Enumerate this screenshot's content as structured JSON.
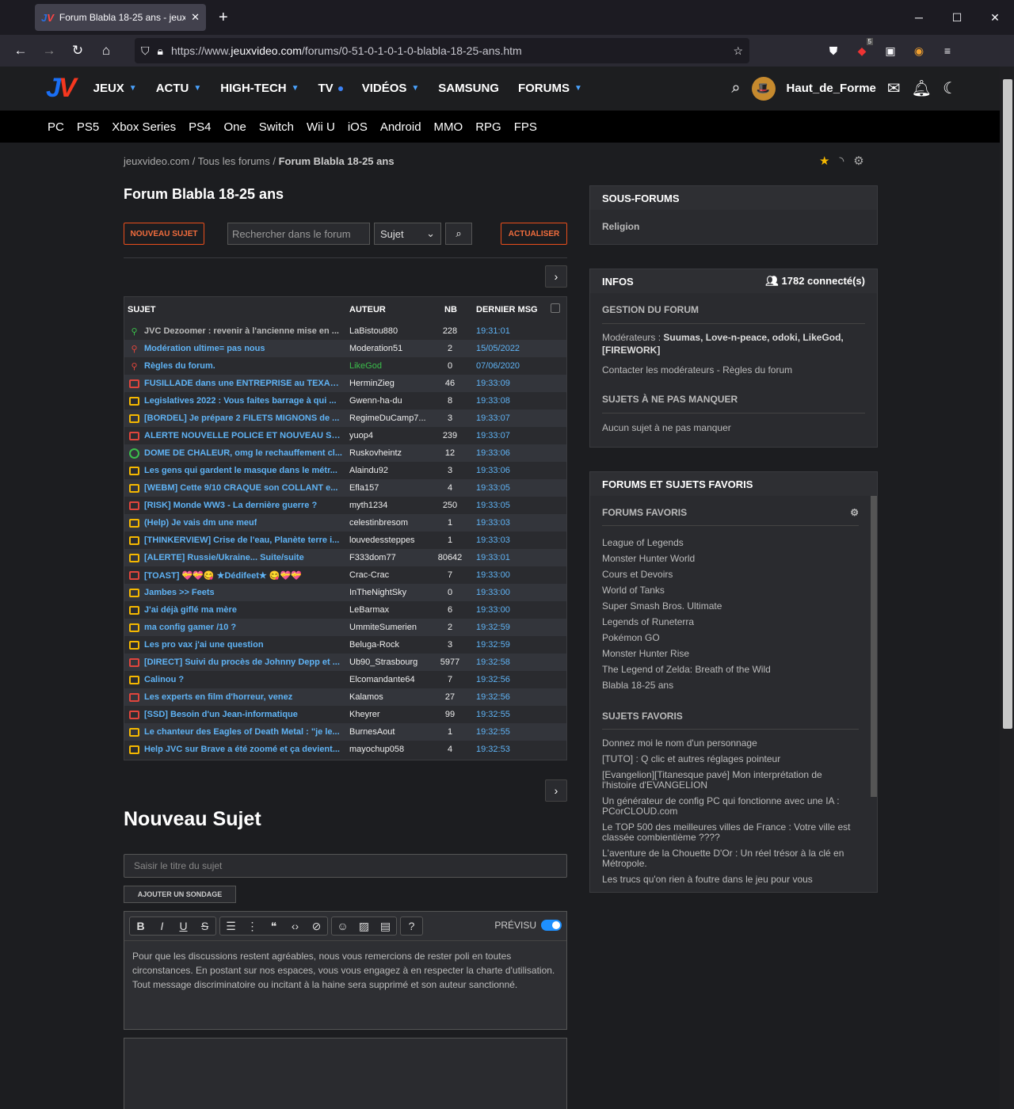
{
  "browser": {
    "tab_title": "Forum Blabla 18-25 ans - jeuxvi",
    "url_prefix": "https://www.",
    "url_domain": "jeuxvideo.com",
    "url_path": "/forums/0-51-0-1-0-1-0-blabla-18-25-ans.htm",
    "ext_badge": "5"
  },
  "site": {
    "nav": [
      {
        "label": "JEUX",
        "marker": "caret"
      },
      {
        "label": "ACTU",
        "marker": "caret"
      },
      {
        "label": "HIGH-TECH",
        "marker": "caret"
      },
      {
        "label": "TV",
        "marker": "dot"
      },
      {
        "label": "VIDÉOS",
        "marker": "caret"
      },
      {
        "label": "SAMSUNG",
        "marker": ""
      },
      {
        "label": "FORUMS",
        "marker": "caret"
      }
    ],
    "username": "Haut_de_Forme",
    "platforms": [
      "PC",
      "PS5",
      "Xbox Series",
      "PS4",
      "One",
      "Switch",
      "Wii U",
      "iOS",
      "Android",
      "MMO",
      "RPG",
      "FPS"
    ]
  },
  "breadcrumb": {
    "home": "jeuxvideo.com",
    "forums": "Tous les forums",
    "current": "Forum Blabla 18-25 ans"
  },
  "page_title": "Forum Blabla 18-25 ans",
  "toolbar": {
    "new_topic": "NOUVEAU SUJET",
    "search_placeholder": "Rechercher dans le forum",
    "search_scope": "Sujet",
    "refresh": "ACTUALISER"
  },
  "table": {
    "headers": {
      "subject": "SUJET",
      "author": "AUTEUR",
      "nb": "NB",
      "last": "DERNIER MSG"
    },
    "rows": [
      {
        "icon": "pin-green",
        "title": "JVC Dezoomer : revenir à l'ancienne mise en ...",
        "author": "LaBistou880",
        "nb": "228",
        "date": "19:31:01"
      },
      {
        "icon": "pin-red",
        "title": "Modération ultime= pas nous",
        "author": "Moderation51",
        "nb": "2",
        "date": "15/05/2022"
      },
      {
        "icon": "pin-red",
        "title": "Règles du forum.",
        "author": "LikeGod",
        "nb": "0",
        "date": "07/06/2020",
        "author_color": "#3bbf4b"
      },
      {
        "icon": "folder-red",
        "title": "FUSILLADE dans une ENTREPRISE au TEXAS ...",
        "author": "HerminZieg",
        "nb": "46",
        "date": "19:33:09"
      },
      {
        "icon": "folder",
        "title": "Legislatives 2022 : Vous faites barrage à qui ...",
        "author": "Gwenn-ha-du",
        "nb": "8",
        "date": "19:33:08"
      },
      {
        "icon": "folder",
        "title": "[BORDEL] Je prépare 2 FILETS MIGNONS de ...",
        "author": "RegimeDuCamp7...",
        "nb": "3",
        "date": "19:33:07"
      },
      {
        "icon": "folder-red",
        "title": "ALERTE NOUVELLE POLICE ET NOUVEAU SM...",
        "author": "yuop4",
        "nb": "239",
        "date": "19:33:07"
      },
      {
        "icon": "check",
        "title": "DOME DE CHALEUR, omg le rechauffement cl...",
        "author": "Ruskovheintz",
        "nb": "12",
        "date": "19:33:06"
      },
      {
        "icon": "folder",
        "title": "Les gens qui gardent le masque dans le métr...",
        "author": "Alaindu92",
        "nb": "3",
        "date": "19:33:06"
      },
      {
        "icon": "folder",
        "title": "[WEBM] Cette 9/10 CRAQUE son COLLANT e...",
        "author": "Efla157",
        "nb": "4",
        "date": "19:33:05"
      },
      {
        "icon": "folder-red",
        "title": "[RISK] Monde WW3 - La dernière guerre ?",
        "author": "myth1234",
        "nb": "250",
        "date": "19:33:05"
      },
      {
        "icon": "folder",
        "title": "(Help) Je vais dm une meuf",
        "author": "celestinbresom",
        "nb": "1",
        "date": "19:33:03"
      },
      {
        "icon": "folder",
        "title": "[THINKERVIEW] Crise de l'eau, Planète terre i...",
        "author": "louvedessteppes",
        "nb": "1",
        "date": "19:33:03"
      },
      {
        "icon": "folder",
        "title": "[ALERTE] Russie/Ukraine... Suite/suite",
        "author": "F333dom77",
        "nb": "80642",
        "date": "19:33:01"
      },
      {
        "icon": "folder-red",
        "title": "[TOAST] 💝💝😋 ★Dédifeet★ 😋💝💝",
        "author": "Crac-Crac",
        "nb": "7",
        "date": "19:33:00"
      },
      {
        "icon": "folder",
        "title": "Jambes >> Feets",
        "author": "InTheNightSky",
        "nb": "0",
        "date": "19:33:00"
      },
      {
        "icon": "folder",
        "title": "J'ai déjà giflé ma mère",
        "author": "LeBarmax",
        "nb": "6",
        "date": "19:33:00"
      },
      {
        "icon": "folder",
        "title": "ma config gamer /10 ?",
        "author": "UmmiteSumerien",
        "nb": "2",
        "date": "19:32:59"
      },
      {
        "icon": "folder",
        "title": "Les pro vax j'ai une question",
        "author": "Beluga-Rock",
        "nb": "3",
        "date": "19:32:59"
      },
      {
        "icon": "folder-red",
        "title": "[DIRECT] Suivi du procès de Johnny Depp et ...",
        "author": "Ub90_Strasbourg",
        "nb": "5977",
        "date": "19:32:58"
      },
      {
        "icon": "folder",
        "title": "Calinou ?",
        "author": "Elcomandante64",
        "nb": "7",
        "date": "19:32:56"
      },
      {
        "icon": "folder-red",
        "title": "Les experts en film d'horreur, venez",
        "author": "Kalamos",
        "nb": "27",
        "date": "19:32:56"
      },
      {
        "icon": "folder-red",
        "title": "[SSD] Besoin d'un Jean-informatique",
        "author": "Kheyrer",
        "nb": "99",
        "date": "19:32:55"
      },
      {
        "icon": "folder",
        "title": "Le chanteur des Eagles of Death Metal : \"je le...",
        "author": "BurnesAout",
        "nb": "1",
        "date": "19:32:55"
      },
      {
        "icon": "folder",
        "title": "Help JVC sur Brave a été zoomé et ça devient...",
        "author": "mayochup058",
        "nb": "4",
        "date": "19:32:53"
      }
    ]
  },
  "new_topic": {
    "heading": "Nouveau Sujet",
    "title_placeholder": "Saisir le titre du sujet",
    "poll_button": "AJOUTER UN SONDAGE",
    "preview_label": "PRÉVISU",
    "notice": "Pour que les discussions restent agréables, nous vous remercions de rester poli en toutes circonstances. En postant sur nos espaces, vous vous engagez à en respecter la charte d'utilisation. Tout message discriminatoire ou incitant à la haine sera supprimé et son auteur sanctionné."
  },
  "sidebar": {
    "subforums_title": "SOUS-FORUMS",
    "subforums": [
      "Religion"
    ],
    "infos_title": "INFOS",
    "connected": "1782 connecté(s)",
    "gestion_title": "GESTION DU FORUM",
    "moderators_label": "Modérateurs :",
    "moderators": "Suumas, Love-n-peace, odoki, LikeGod, [FIREWORK]",
    "contact": "Contacter les modérateurs",
    "rules": "Règles du forum",
    "must_title": "SUJETS À NE PAS MANQUER",
    "must_none": "Aucun sujet à ne pas manquer",
    "fav_title": "FORUMS ET SUJETS FAVORIS",
    "fav_forums_title": "FORUMS FAVORIS",
    "fav_forums": [
      "League of Legends",
      "Monster Hunter World",
      "Cours et Devoirs",
      "World of Tanks",
      "Super Smash Bros. Ultimate",
      "Legends of Runeterra",
      "Pokémon GO",
      "Monster Hunter Rise",
      "The Legend of Zelda: Breath of the Wild",
      "Blabla 18-25 ans"
    ],
    "fav_topics_title": "SUJETS FAVORIS",
    "fav_topics": [
      "Donnez moi le nom d'un personnage",
      "[TUTO] : Q clic et autres réglages pointeur",
      "[Evangelion][Titanesque pavé] Mon interprétation de l'histoire d'EVANGELION",
      "Un générateur de config PC qui fonctionne avec une IA : PCorCLOUD.com",
      "Le TOP 500 des meilleures villes de France : Votre ville est classée combientième ????",
      "L'aventure de la Chouette D'Or : Un réel trésor à la clé en Métropole.",
      "Les trucs qu'on rien à foutre dans le jeu pour vous"
    ]
  }
}
